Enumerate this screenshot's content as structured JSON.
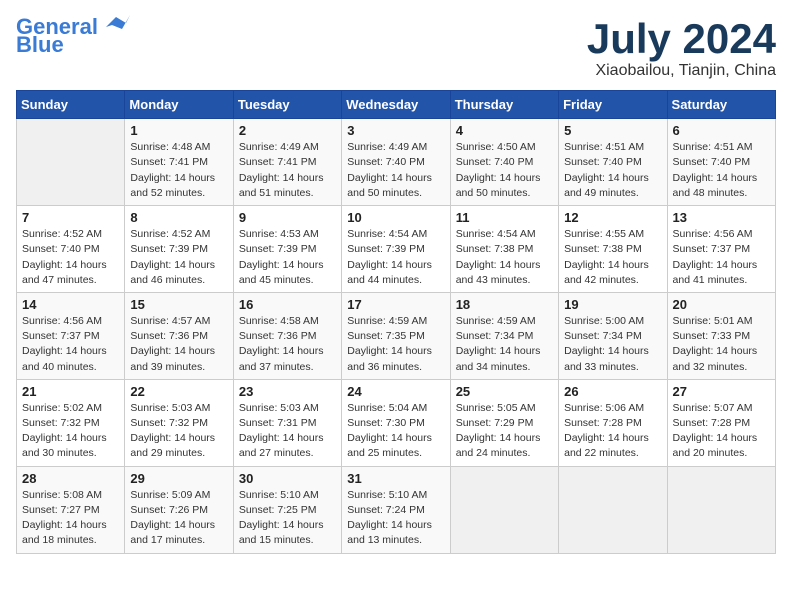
{
  "logo": {
    "line1": "General",
    "line2": "Blue"
  },
  "title": "July 2024",
  "location": "Xiaobailou, Tianjin, China",
  "weekdays": [
    "Sunday",
    "Monday",
    "Tuesday",
    "Wednesday",
    "Thursday",
    "Friday",
    "Saturday"
  ],
  "weeks": [
    [
      {
        "day": "",
        "sunrise": "",
        "sunset": "",
        "daylight": ""
      },
      {
        "day": "1",
        "sunrise": "Sunrise: 4:48 AM",
        "sunset": "Sunset: 7:41 PM",
        "daylight": "Daylight: 14 hours and 52 minutes."
      },
      {
        "day": "2",
        "sunrise": "Sunrise: 4:49 AM",
        "sunset": "Sunset: 7:41 PM",
        "daylight": "Daylight: 14 hours and 51 minutes."
      },
      {
        "day": "3",
        "sunrise": "Sunrise: 4:49 AM",
        "sunset": "Sunset: 7:40 PM",
        "daylight": "Daylight: 14 hours and 50 minutes."
      },
      {
        "day": "4",
        "sunrise": "Sunrise: 4:50 AM",
        "sunset": "Sunset: 7:40 PM",
        "daylight": "Daylight: 14 hours and 50 minutes."
      },
      {
        "day": "5",
        "sunrise": "Sunrise: 4:51 AM",
        "sunset": "Sunset: 7:40 PM",
        "daylight": "Daylight: 14 hours and 49 minutes."
      },
      {
        "day": "6",
        "sunrise": "Sunrise: 4:51 AM",
        "sunset": "Sunset: 7:40 PM",
        "daylight": "Daylight: 14 hours and 48 minutes."
      }
    ],
    [
      {
        "day": "7",
        "sunrise": "Sunrise: 4:52 AM",
        "sunset": "Sunset: 7:40 PM",
        "daylight": "Daylight: 14 hours and 47 minutes."
      },
      {
        "day": "8",
        "sunrise": "Sunrise: 4:52 AM",
        "sunset": "Sunset: 7:39 PM",
        "daylight": "Daylight: 14 hours and 46 minutes."
      },
      {
        "day": "9",
        "sunrise": "Sunrise: 4:53 AM",
        "sunset": "Sunset: 7:39 PM",
        "daylight": "Daylight: 14 hours and 45 minutes."
      },
      {
        "day": "10",
        "sunrise": "Sunrise: 4:54 AM",
        "sunset": "Sunset: 7:39 PM",
        "daylight": "Daylight: 14 hours and 44 minutes."
      },
      {
        "day": "11",
        "sunrise": "Sunrise: 4:54 AM",
        "sunset": "Sunset: 7:38 PM",
        "daylight": "Daylight: 14 hours and 43 minutes."
      },
      {
        "day": "12",
        "sunrise": "Sunrise: 4:55 AM",
        "sunset": "Sunset: 7:38 PM",
        "daylight": "Daylight: 14 hours and 42 minutes."
      },
      {
        "day": "13",
        "sunrise": "Sunrise: 4:56 AM",
        "sunset": "Sunset: 7:37 PM",
        "daylight": "Daylight: 14 hours and 41 minutes."
      }
    ],
    [
      {
        "day": "14",
        "sunrise": "Sunrise: 4:56 AM",
        "sunset": "Sunset: 7:37 PM",
        "daylight": "Daylight: 14 hours and 40 minutes."
      },
      {
        "day": "15",
        "sunrise": "Sunrise: 4:57 AM",
        "sunset": "Sunset: 7:36 PM",
        "daylight": "Daylight: 14 hours and 39 minutes."
      },
      {
        "day": "16",
        "sunrise": "Sunrise: 4:58 AM",
        "sunset": "Sunset: 7:36 PM",
        "daylight": "Daylight: 14 hours and 37 minutes."
      },
      {
        "day": "17",
        "sunrise": "Sunrise: 4:59 AM",
        "sunset": "Sunset: 7:35 PM",
        "daylight": "Daylight: 14 hours and 36 minutes."
      },
      {
        "day": "18",
        "sunrise": "Sunrise: 4:59 AM",
        "sunset": "Sunset: 7:34 PM",
        "daylight": "Daylight: 14 hours and 34 minutes."
      },
      {
        "day": "19",
        "sunrise": "Sunrise: 5:00 AM",
        "sunset": "Sunset: 7:34 PM",
        "daylight": "Daylight: 14 hours and 33 minutes."
      },
      {
        "day": "20",
        "sunrise": "Sunrise: 5:01 AM",
        "sunset": "Sunset: 7:33 PM",
        "daylight": "Daylight: 14 hours and 32 minutes."
      }
    ],
    [
      {
        "day": "21",
        "sunrise": "Sunrise: 5:02 AM",
        "sunset": "Sunset: 7:32 PM",
        "daylight": "Daylight: 14 hours and 30 minutes."
      },
      {
        "day": "22",
        "sunrise": "Sunrise: 5:03 AM",
        "sunset": "Sunset: 7:32 PM",
        "daylight": "Daylight: 14 hours and 29 minutes."
      },
      {
        "day": "23",
        "sunrise": "Sunrise: 5:03 AM",
        "sunset": "Sunset: 7:31 PM",
        "daylight": "Daylight: 14 hours and 27 minutes."
      },
      {
        "day": "24",
        "sunrise": "Sunrise: 5:04 AM",
        "sunset": "Sunset: 7:30 PM",
        "daylight": "Daylight: 14 hours and 25 minutes."
      },
      {
        "day": "25",
        "sunrise": "Sunrise: 5:05 AM",
        "sunset": "Sunset: 7:29 PM",
        "daylight": "Daylight: 14 hours and 24 minutes."
      },
      {
        "day": "26",
        "sunrise": "Sunrise: 5:06 AM",
        "sunset": "Sunset: 7:28 PM",
        "daylight": "Daylight: 14 hours and 22 minutes."
      },
      {
        "day": "27",
        "sunrise": "Sunrise: 5:07 AM",
        "sunset": "Sunset: 7:28 PM",
        "daylight": "Daylight: 14 hours and 20 minutes."
      }
    ],
    [
      {
        "day": "28",
        "sunrise": "Sunrise: 5:08 AM",
        "sunset": "Sunset: 7:27 PM",
        "daylight": "Daylight: 14 hours and 18 minutes."
      },
      {
        "day": "29",
        "sunrise": "Sunrise: 5:09 AM",
        "sunset": "Sunset: 7:26 PM",
        "daylight": "Daylight: 14 hours and 17 minutes."
      },
      {
        "day": "30",
        "sunrise": "Sunrise: 5:10 AM",
        "sunset": "Sunset: 7:25 PM",
        "daylight": "Daylight: 14 hours and 15 minutes."
      },
      {
        "day": "31",
        "sunrise": "Sunrise: 5:10 AM",
        "sunset": "Sunset: 7:24 PM",
        "daylight": "Daylight: 14 hours and 13 minutes."
      },
      {
        "day": "",
        "sunrise": "",
        "sunset": "",
        "daylight": ""
      },
      {
        "day": "",
        "sunrise": "",
        "sunset": "",
        "daylight": ""
      },
      {
        "day": "",
        "sunrise": "",
        "sunset": "",
        "daylight": ""
      }
    ]
  ]
}
